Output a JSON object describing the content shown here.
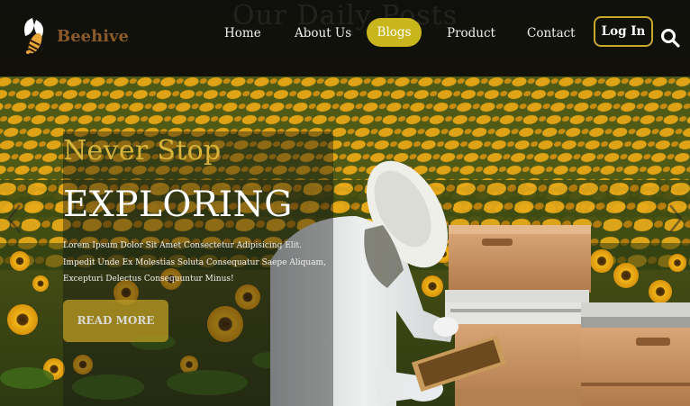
{
  "nav": {
    "ghost_title": "Our Daily Posts",
    "brand": "Beehive",
    "items": [
      {
        "label": "Home"
      },
      {
        "label": "About Us"
      },
      {
        "label": "Blogs",
        "active": true
      },
      {
        "label": "Product"
      },
      {
        "label": "Contact"
      }
    ],
    "login_label": "Log In"
  },
  "hero": {
    "eyebrow": "Never Stop",
    "heading": "EXPLORING",
    "body": "Lorem Ipsum Dolor Sit Amet Consectetur Adipisicing Elit. Impedit Unde Ex Molestias Soluta Consequatur Saepe Aliquam, Excepturi Delectus Consequuntur Minus!",
    "cta_label": "READ MORE"
  },
  "icons": {
    "logo": "bee-logo-icon",
    "search": "search-icon",
    "prev": "chevron-left-icon",
    "next": "chevron-right-icon"
  },
  "colors": {
    "accent": "#c9b61d",
    "brand_text": "#8a5a2a",
    "eyebrow": "#d8b53a",
    "navbar_bg": "#0a0a0a"
  }
}
